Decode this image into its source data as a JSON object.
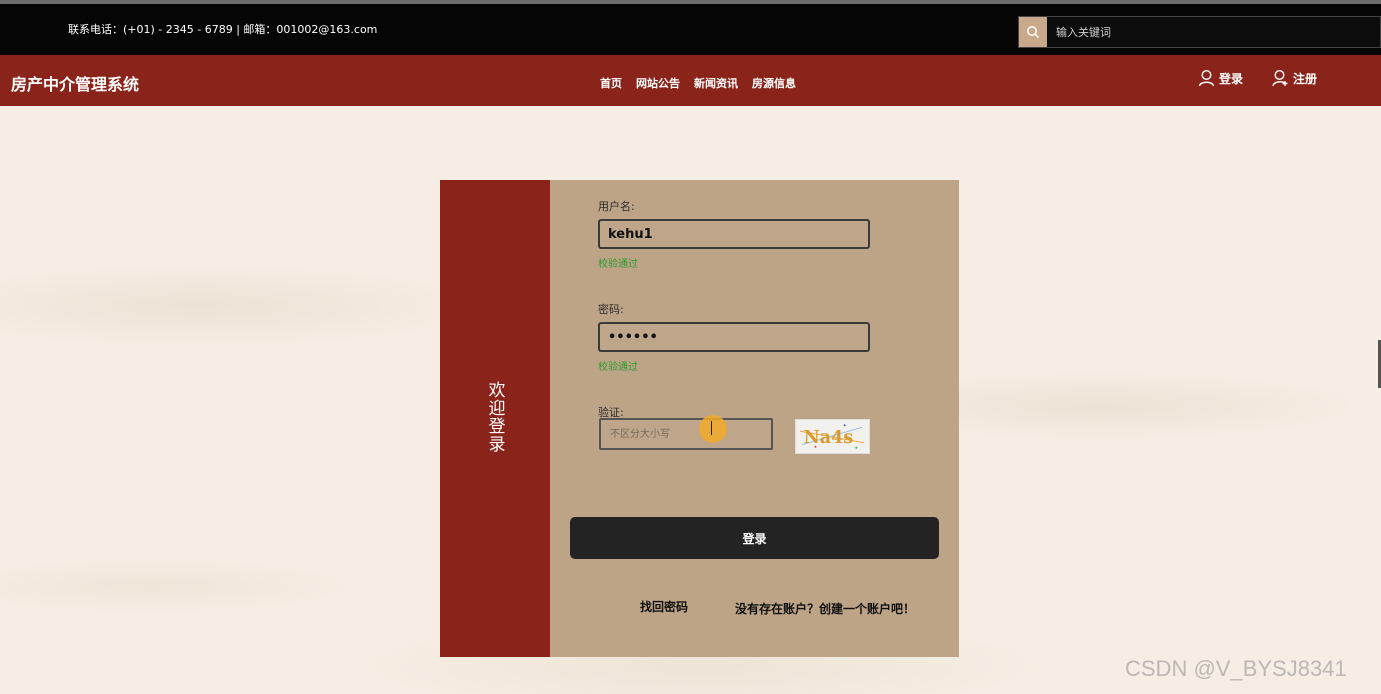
{
  "topbar": {
    "contact": "联系电话：(+01) - 2345 - 6789 | 邮箱：001002@163.com",
    "search_placeholder": "输入关键词",
    "search_icon": "search-icon",
    "accent_color": "#c8a98a"
  },
  "navbar": {
    "brand": "房产中介管理系统",
    "links": [
      "首页",
      "网站公告",
      "新闻资讯",
      "房源信息"
    ],
    "login_label": "登录",
    "register_label": "注册",
    "bg_color": "#8a241a"
  },
  "login_card": {
    "side_title": "欢迎登录",
    "username_label": "用户名:",
    "username_value": "kehu1",
    "username_hint": "校验通过",
    "password_label": "密码:",
    "password_value": "••••••",
    "password_hint": "校验通过",
    "captcha_label": "验证:",
    "captcha_placeholder": "不区分大小写",
    "captcha_text": "Na4s",
    "login_button": "登录",
    "forgot_password": "找回密码",
    "create_account": "没有存在账户？创建一个账户吧！"
  },
  "watermark": "CSDN @V_BYSJ8341"
}
